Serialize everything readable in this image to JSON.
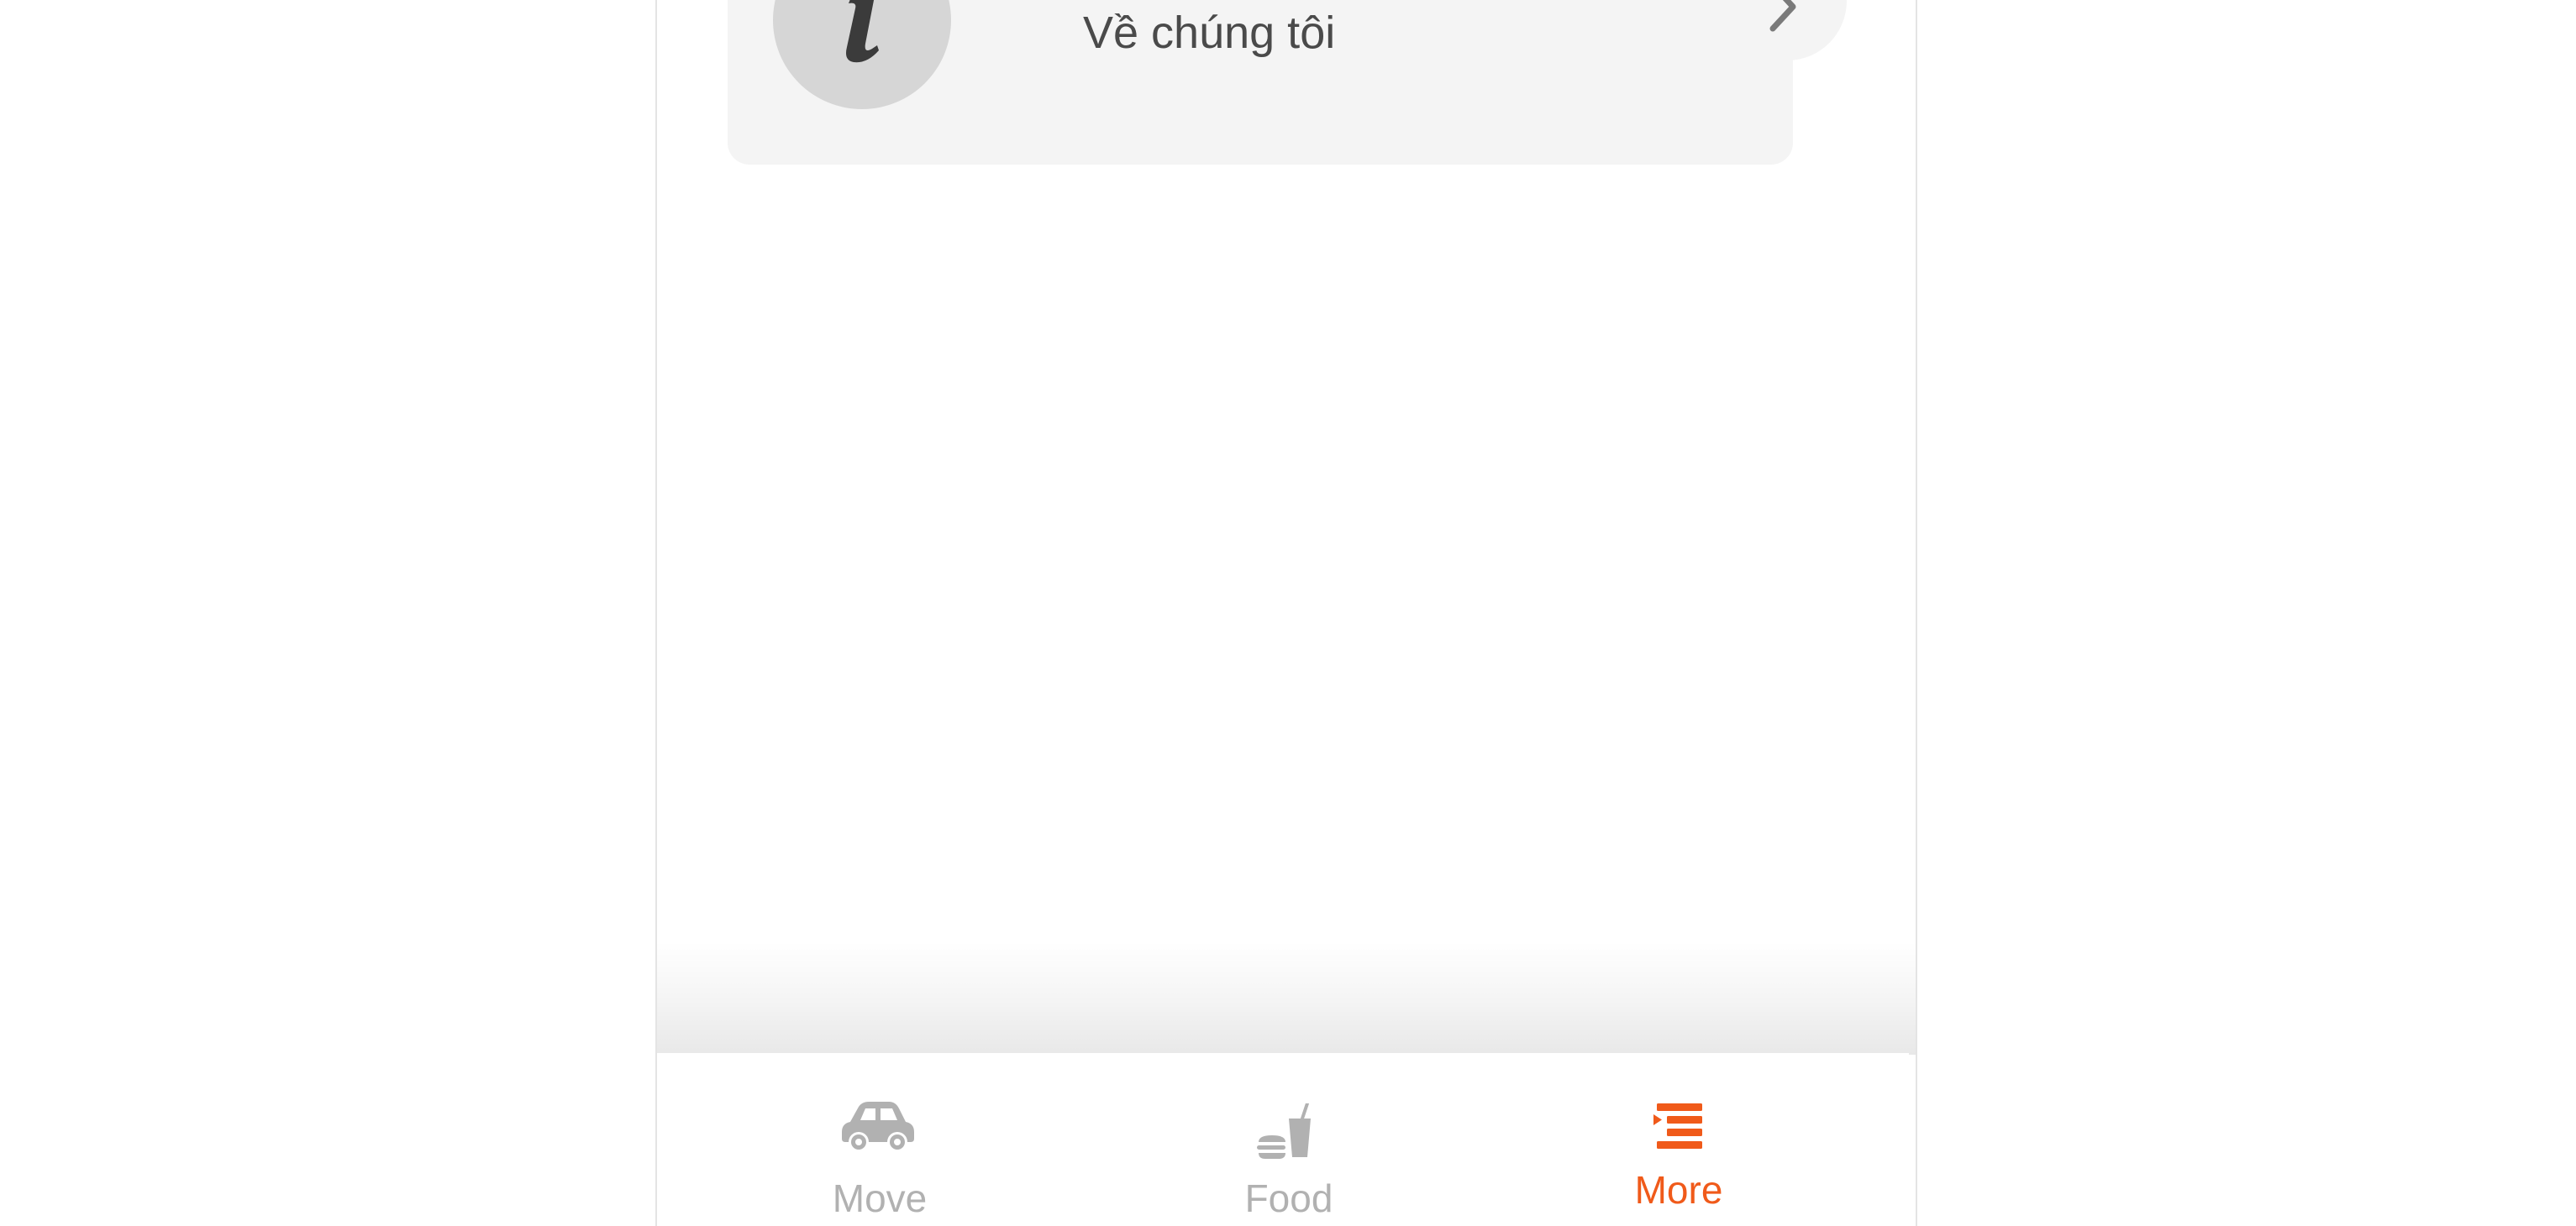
{
  "menu": {
    "items": [
      {
        "label": "Về chúng tôi",
        "icon": "info-icon"
      }
    ]
  },
  "tabs": [
    {
      "label": "Move",
      "icon": "car-icon",
      "active": false
    },
    {
      "label": "Food",
      "icon": "food-drink-icon",
      "active": false
    },
    {
      "label": "More",
      "icon": "list-menu-icon",
      "active": true
    }
  ],
  "colors": {
    "accent": "#f05a1a",
    "inactive": "#b1b1b1",
    "card_background": "#f4f4f4",
    "avatar_background": "#d6d6d6",
    "label_text": "#4a4a4a"
  }
}
